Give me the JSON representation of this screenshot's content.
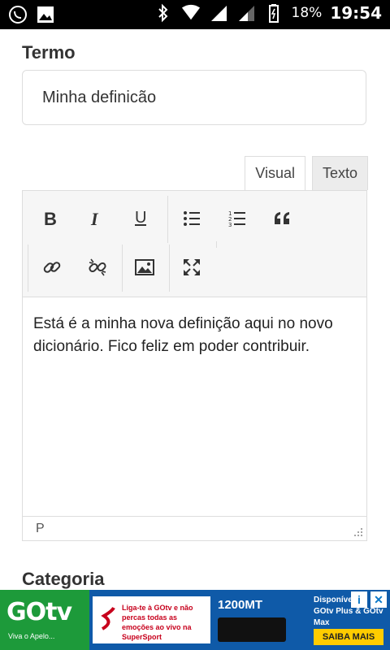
{
  "status_bar": {
    "battery_text": "18%",
    "time": "19:54",
    "icons": [
      "whatsapp-icon",
      "image-icon",
      "bluetooth-icon",
      "wifi-icon",
      "signal-icon",
      "signal-icon",
      "battery-icon"
    ]
  },
  "form": {
    "term_label": "Termo",
    "term_value": "Minha definicão",
    "tabs": [
      {
        "label": "Visual",
        "active": true
      },
      {
        "label": "Texto",
        "active": false
      }
    ],
    "toolbar_buttons": [
      "bold",
      "italic",
      "underline",
      "bullet-list",
      "numbered-list",
      "blockquote",
      "link",
      "unlink",
      "image",
      "fullscreen"
    ],
    "content_text": "Está é a minha nova definição aqui no novo dicionário. Fico feliz em poder contribuir.",
    "status_path": "P",
    "category_label": "Categoria"
  },
  "ad": {
    "logo": "GOtv",
    "logo_sub": "Viva o Apelo...",
    "mid_text": "Liga-te à GOtv e não percas todas as emoções ao vivo na SuperSport",
    "price": "1200MT",
    "right_text": "Disponível no GOtv Plus & GOtv Max",
    "cta": "SAIBA MAIS",
    "info_label": "i",
    "close_label": "✕"
  }
}
